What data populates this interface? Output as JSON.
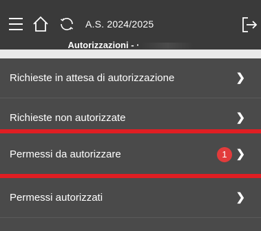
{
  "header": {
    "school_year": "A.S. 2024/2025",
    "section_title": "Autorizzazioni - ·"
  },
  "icons": {
    "menu": "menu-icon",
    "home": "home-icon",
    "sync": "sync-icon",
    "logout": "logout-icon"
  },
  "list": {
    "items": [
      {
        "label": "Richieste in attesa di autorizzazione",
        "chevron": "❯"
      },
      {
        "label": "Richieste non autorizzate",
        "chevron": "❯"
      },
      {
        "label": "Permessi da autorizzare",
        "badge": "1",
        "chevron": "❯"
      },
      {
        "label": "Permessi autorizzati",
        "chevron": "❯"
      }
    ]
  },
  "colors": {
    "topbar": "#3a3a3a",
    "list_bg": "#4a4a4a",
    "highlight": "#e01e23",
    "badge": "#e23b3b"
  }
}
